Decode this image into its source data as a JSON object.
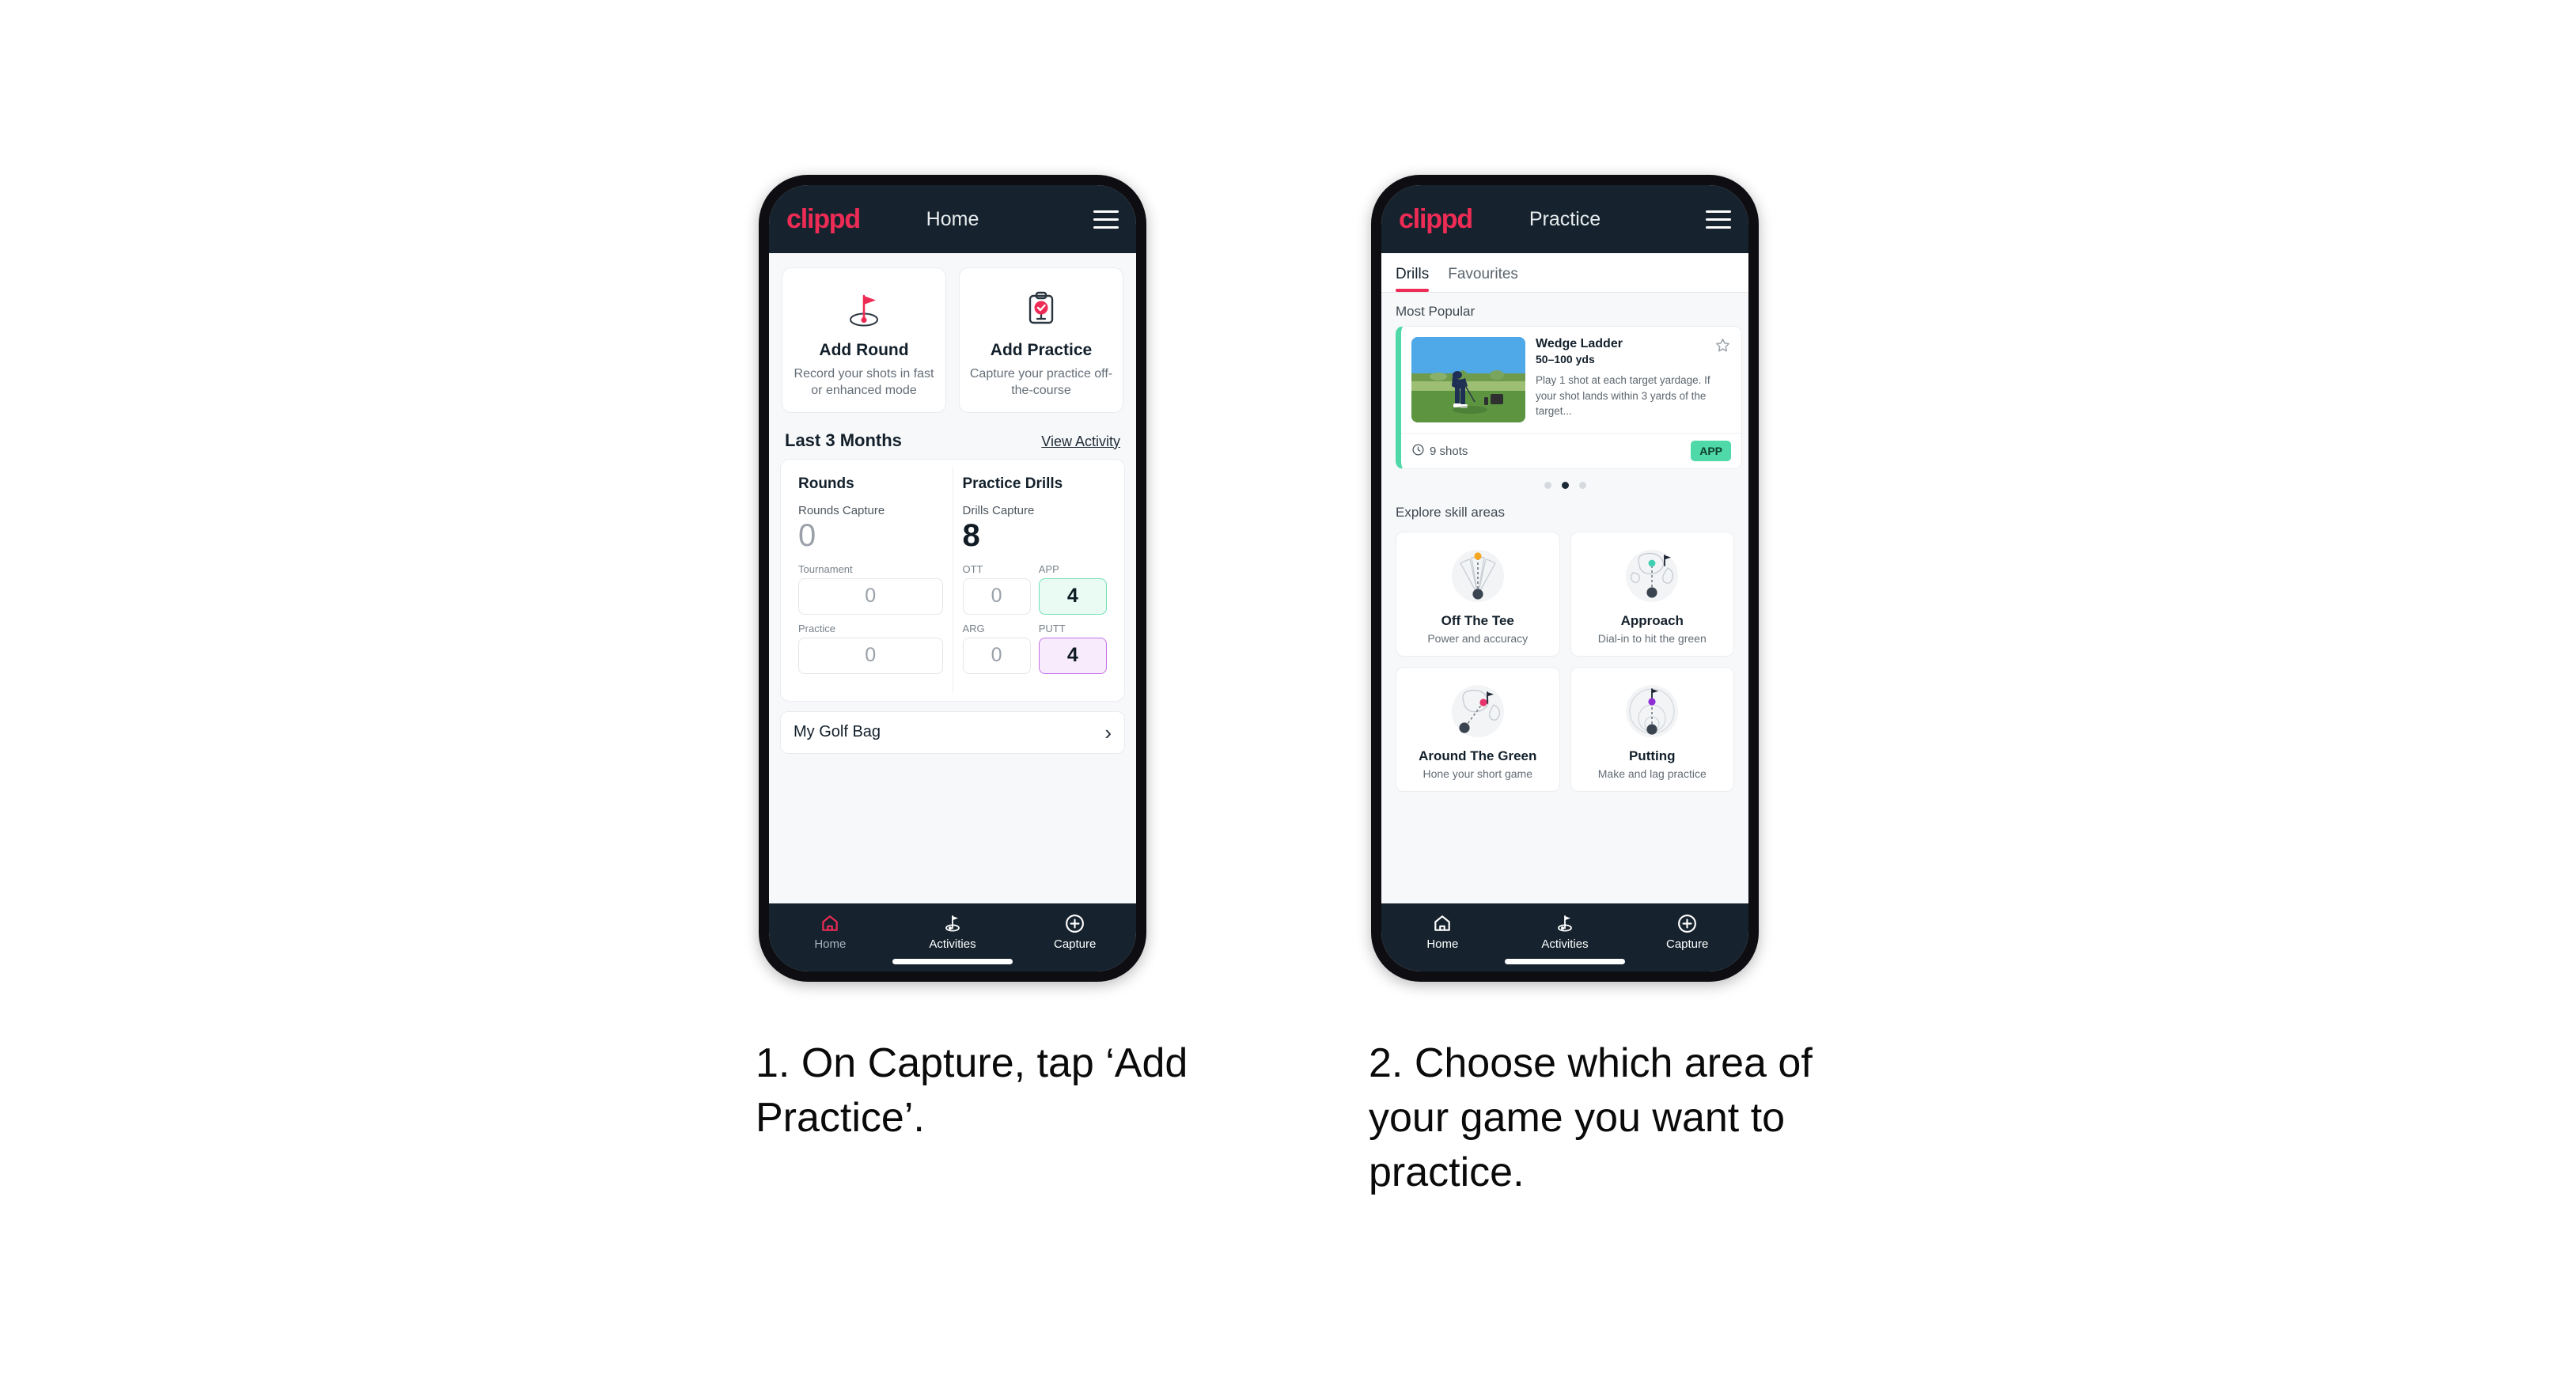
{
  "phone1": {
    "appbar": {
      "logo": "clippd",
      "title": "Home",
      "menu_icon": "hamburger-icon"
    },
    "actions": [
      {
        "icon": "golf-flag-icon",
        "title": "Add Round",
        "subtitle": "Record your shots in fast or enhanced mode"
      },
      {
        "icon": "clipboard-check-icon",
        "title": "Add Practice",
        "subtitle": "Capture your practice off-the-course"
      }
    ],
    "section": {
      "title": "Last 3 Months",
      "link": "View Activity"
    },
    "rounds": {
      "title": "Rounds",
      "capture_label": "Rounds Capture",
      "capture_value": "0",
      "boxes": [
        {
          "label": "Tournament",
          "value": "0",
          "state": "empty"
        },
        {
          "label": "Practice",
          "value": "0",
          "state": "empty"
        }
      ]
    },
    "drills": {
      "title": "Practice Drills",
      "capture_label": "Drills Capture",
      "capture_value": "8",
      "boxes": [
        {
          "label": "OTT",
          "value": "0",
          "state": "empty"
        },
        {
          "label": "APP",
          "value": "4",
          "state": "green"
        },
        {
          "label": "ARG",
          "value": "0",
          "state": "empty"
        },
        {
          "label": "PUTT",
          "value": "4",
          "state": "purple"
        }
      ]
    },
    "golf_bag": {
      "label": "My Golf Bag",
      "chevron": "chevron-right-icon"
    },
    "nav": [
      {
        "icon": "home-icon",
        "label": "Home",
        "active": true
      },
      {
        "icon": "golf-activities-icon",
        "label": "Activities",
        "active": false
      },
      {
        "icon": "plus-circle-icon",
        "label": "Capture",
        "active": false
      }
    ]
  },
  "phone2": {
    "appbar": {
      "logo": "clippd",
      "title": "Practice",
      "menu_icon": "hamburger-icon"
    },
    "tabs": [
      {
        "label": "Drills",
        "active": true
      },
      {
        "label": "Favourites",
        "active": false
      }
    ],
    "most_popular_label": "Most Popular",
    "drill": {
      "name": "Wedge Ladder",
      "yardage": "50–100 yds",
      "description": "Play 1 shot at each target yardage. If your shot lands within 3 yards of the target...",
      "shots": "9 shots",
      "shots_icon": "clock-icon",
      "badge": "APP",
      "favourite_icon": "star-outline-icon",
      "accent_color": "#4fd9a8",
      "next_accent_color": "#b23de0"
    },
    "carousel_dots": {
      "count": 3,
      "active_index": 1
    },
    "explore_label": "Explore skill areas",
    "skills": [
      {
        "icon": "tee-shot-dispersion-icon",
        "name": "Off The Tee",
        "subtitle": "Power and accuracy",
        "dot_color": "#f5a623"
      },
      {
        "icon": "approach-green-icon",
        "name": "Approach",
        "subtitle": "Dial-in to hit the green",
        "dot_color": "#3ecfb0"
      },
      {
        "icon": "chip-green-icon",
        "name": "Around The Green",
        "subtitle": "Hone your short game",
        "dot_color": "#e8336d"
      },
      {
        "icon": "putting-circles-icon",
        "name": "Putting",
        "subtitle": "Make and lag practice",
        "dot_color": "#8e2fd6"
      }
    ],
    "nav": [
      {
        "icon": "home-icon",
        "label": "Home",
        "active": false
      },
      {
        "icon": "golf-activities-icon",
        "label": "Activities",
        "active": true
      },
      {
        "icon": "plus-circle-icon",
        "label": "Capture",
        "active": false
      }
    ]
  },
  "captions": {
    "step1": "1. On Capture, tap ‘Add Practice’.",
    "step2": "2. Choose which area of your game you want to practice."
  },
  "colors": {
    "brand_pink": "#ee2b55",
    "dark_navy": "#16232e",
    "app_background": "#f7f8fa",
    "green_accent": "#4fd9a8",
    "purple_accent": "#b23de0"
  }
}
